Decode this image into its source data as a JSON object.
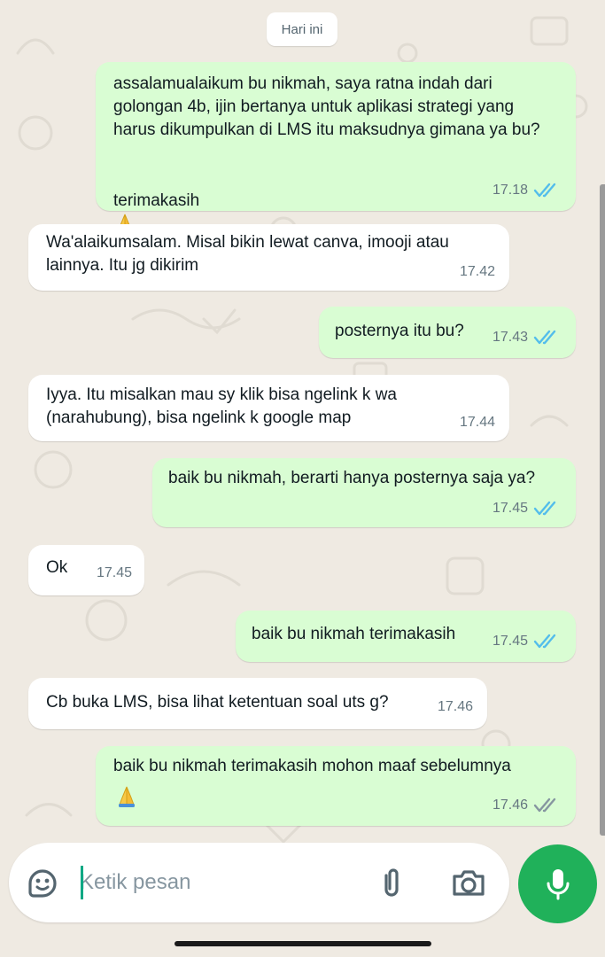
{
  "chat": {
    "date_label": "Hari ini",
    "messages": [
      {
        "direction": "outgoing",
        "text": "assalamualaikum bu nikmah, saya ratna indah dari golongan 4b, ijin bertanya untuk aplikasi strategi yang harus dikumpulkan di LMS itu maksudnya gimana ya bu?",
        "text2": "terimakasih",
        "emoji": "folded-hands",
        "time": "17.18",
        "status": "read"
      },
      {
        "direction": "incoming",
        "text": "Wa'alaikumsalam. Misal bikin lewat canva, imooji atau lainnya. Itu jg dikirim",
        "time": "17.42"
      },
      {
        "direction": "outgoing",
        "text": "posternya itu bu?",
        "time": "17.43",
        "status": "read"
      },
      {
        "direction": "incoming",
        "text": "Iyya. Itu misalkan mau sy klik bisa ngelink k wa (narahubung), bisa ngelink k google map",
        "time": "17.44"
      },
      {
        "direction": "outgoing",
        "text": "baik bu nikmah, berarti hanya posternya saja ya?",
        "time": "17.45",
        "status": "read"
      },
      {
        "direction": "incoming",
        "text": "Ok",
        "time": "17.45"
      },
      {
        "direction": "outgoing",
        "text": "baik bu nikmah terimakasih",
        "time": "17.45",
        "status": "read"
      },
      {
        "direction": "incoming",
        "text": "Cb buka LMS, bisa lihat ketentuan soal uts g?",
        "time": "17.46"
      },
      {
        "direction": "outgoing",
        "text": "baik bu nikmah terimakasih mohon maaf sebelumnya",
        "emoji": "folded-hands",
        "time": "17.46",
        "status": "delivered"
      }
    ]
  },
  "composer": {
    "placeholder": "Ketik pesan",
    "sticker_icon": "sticker-icon",
    "attach_icon": "paperclip-icon",
    "camera_icon": "camera-icon",
    "mic_icon": "microphone-icon"
  },
  "colors": {
    "background": "#efeae2",
    "outgoing_bubble": "#d9fdd3",
    "incoming_bubble": "#ffffff",
    "read_tick": "#53bdeb",
    "delivered_tick": "#667781",
    "mic_button": "#20b15a"
  }
}
